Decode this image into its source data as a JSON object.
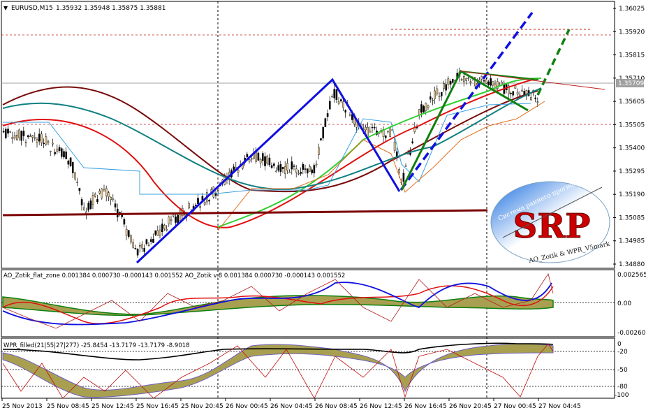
{
  "window": {
    "symbol": "EURUSD,M15",
    "ohlc": "1.35932 1.35948 1.35875 1.35881",
    "current_price": "1.35709"
  },
  "price_axis": {
    "labels": [
      "1.36025",
      "1.35920",
      "1.35815",
      "1.35710",
      "1.35605",
      "1.35505",
      "1.35400",
      "1.35295",
      "1.35190",
      "1.35085",
      "1.34985",
      "1.34880"
    ],
    "min": 1.3488,
    "max": 1.36025
  },
  "time_axis": {
    "labels": [
      "25 Nov 2013",
      "25 Nov 08:45",
      "25 Nov 12:45",
      "25 Nov 16:45",
      "25 Nov 20:45",
      "26 Nov 00:45",
      "26 Nov 04:45",
      "26 Nov 08:45",
      "26 Nov 12:45",
      "26 Nov 16:45",
      "26 Nov 20:45",
      "27 Nov 00:45",
      "27 Nov 04:45"
    ]
  },
  "ao_panel": {
    "title": "AO_Zotik_flat_zone 0.001384 0.000730 -0.000143 0.001552  AO_Zotik v.8 0.001384 0.000730 -0.000143 0.001552",
    "axis_labels": [
      "0.002565",
      "0.00",
      "-0.002609"
    ]
  },
  "wpr_panel": {
    "title": "WPR_filled(21|55|27|277) -25.8454 -13.7179 -13.7179 -8.9018",
    "axis_labels": [
      "0",
      "-20",
      "-50",
      "-80",
      "-100"
    ]
  },
  "logo": {
    "letters": "SRP",
    "arc_text_top": "Система раннего прогнозирования",
    "arc_text_bottom": "AO_Zotik & WPR_V5mark"
  },
  "colors": {
    "blue_pattern": "#1010e0",
    "green_pattern": "#108010",
    "ma_red": "#e01010",
    "ma_darkred": "#7a0a0a",
    "ma_green": "#30d030",
    "ma_teal": "#108080",
    "level_line": "#7a0000"
  }
}
